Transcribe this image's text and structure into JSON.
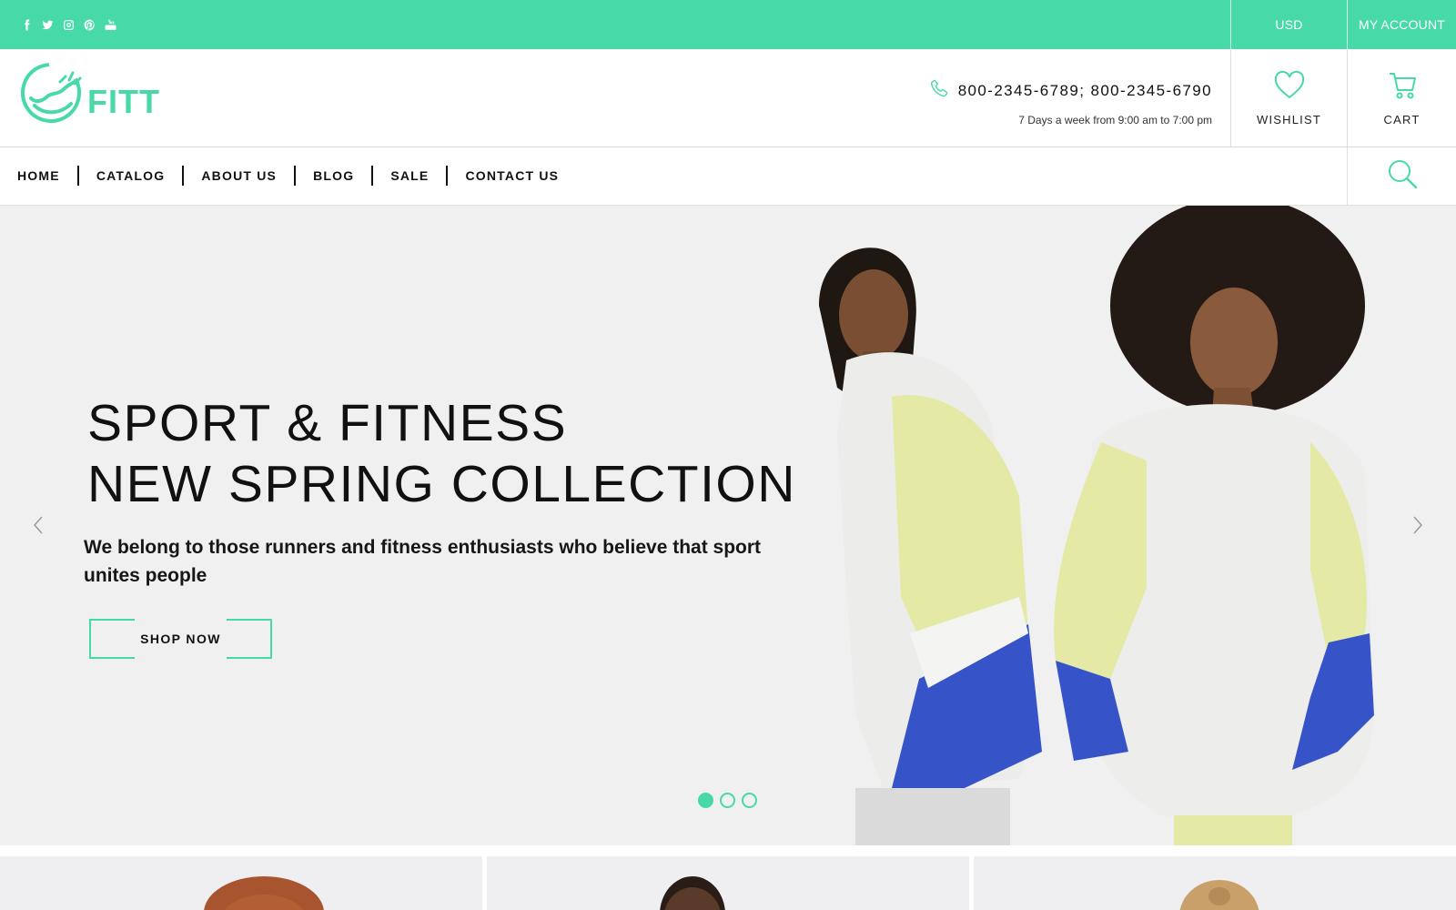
{
  "topbar": {
    "social": [
      "facebook-icon",
      "twitter-icon",
      "instagram-icon",
      "pinterest-icon",
      "youtube-icon"
    ],
    "currency": "USD",
    "account": "MY ACCOUNT",
    "bg_color": "#47d9a8"
  },
  "header": {
    "logo_text": "FITT",
    "phone": "800-2345-6789; 800-2345-6790",
    "hours": "7 Days a week from 9:00 am to 7:00 pm",
    "wishlist_label": "WISHLIST",
    "cart_label": "CART",
    "accent_color": "#47d9a8"
  },
  "nav": {
    "items": [
      "HOME",
      "CATALOG",
      "ABOUT US",
      "BLOG",
      "SALE",
      "CONTACT US"
    ]
  },
  "hero": {
    "title_line1": "SPORT & FITNESS",
    "title_line2": "NEW SPRING COLLECTION",
    "subtitle": "We belong to those runners and fitness enthusiasts who believe that sport unites people",
    "button_label": "SHOP NOW",
    "slides": 3,
    "active_slide": 1
  }
}
